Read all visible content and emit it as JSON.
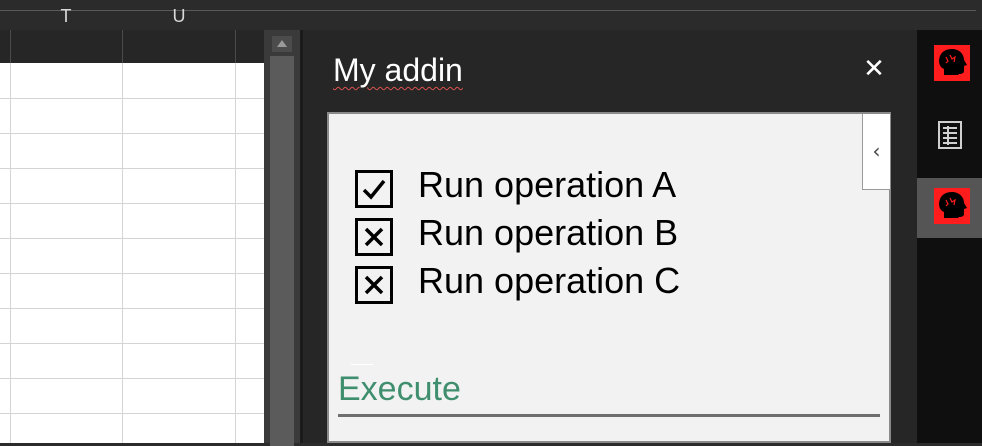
{
  "spreadsheet": {
    "columns": [
      "T",
      "U"
    ]
  },
  "task_pane": {
    "title": "My addin",
    "close_glyph": "✕",
    "collapse_glyph": "‹",
    "operations": [
      {
        "label": "Run operation A",
        "checked": true
      },
      {
        "label": "Run operation B",
        "checked": false
      },
      {
        "label": "Run operation C",
        "checked": false
      }
    ],
    "execute_label": "Execute"
  },
  "app_bar": {
    "items": [
      {
        "icon": "addin-head-icon",
        "active": false
      },
      {
        "icon": "sheet-list-icon",
        "active": false
      },
      {
        "icon": "addin-head-icon",
        "active": true
      }
    ]
  },
  "colors": {
    "accent": "#3f8f6f",
    "addin_icon": "#ff1c1c",
    "spellcheck": "#d9534f"
  }
}
